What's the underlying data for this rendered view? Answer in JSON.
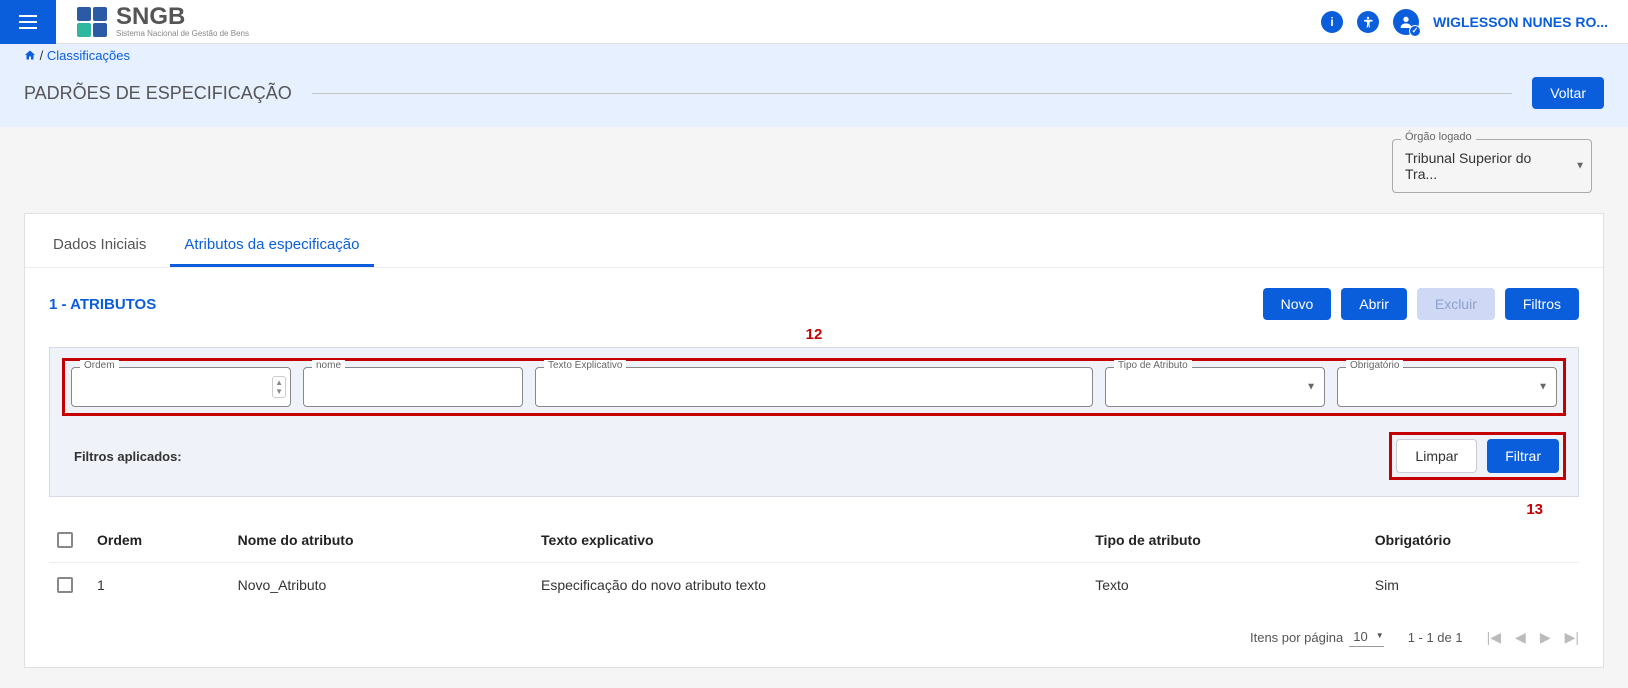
{
  "topbar": {
    "logo_text": "SNGB",
    "logo_sub": "Sistema Nacional de Gestão de Bens",
    "user_name": "WIGLESSON NUNES RO..."
  },
  "breadcrumb": {
    "home_icon": "home",
    "sep": " / ",
    "page": "Classificações"
  },
  "page": {
    "title": "PADRÕES DE ESPECIFICAÇÃO",
    "back_btn": "Voltar"
  },
  "orgao": {
    "label": "Órgão logado",
    "value": "Tribunal Superior do Tra..."
  },
  "tabs": {
    "tab1": "Dados Iniciais",
    "tab2": "Atributos da especificação"
  },
  "section": {
    "title": "1 - ATRIBUTOS",
    "btn_novo": "Novo",
    "btn_abrir": "Abrir",
    "btn_excluir": "Excluir",
    "btn_filtros": "Filtros"
  },
  "annotations": {
    "a12": "12",
    "a13": "13"
  },
  "filters": {
    "ordem_label": "Ordem",
    "nome_label": "nome",
    "texto_label": "Texto Explicativo",
    "tipo_label": "Tipo de Atributo",
    "obr_label": "Obrigatório",
    "applied_label": "Filtros aplicados:",
    "btn_limpar": "Limpar",
    "btn_filtrar": "Filtrar"
  },
  "table": {
    "headers": {
      "ordem": "Ordem",
      "nome": "Nome do atributo",
      "texto": "Texto explicativo",
      "tipo": "Tipo de atributo",
      "obr": "Obrigatório"
    },
    "rows": [
      {
        "ordem": "1",
        "nome": "Novo_Atributo",
        "texto": "Especificação do novo atributo texto",
        "tipo": "Texto",
        "obr": "Sim"
      }
    ]
  },
  "pagination": {
    "items_label": "Itens por página",
    "page_size": "10",
    "range": "1 - 1 de 1"
  }
}
